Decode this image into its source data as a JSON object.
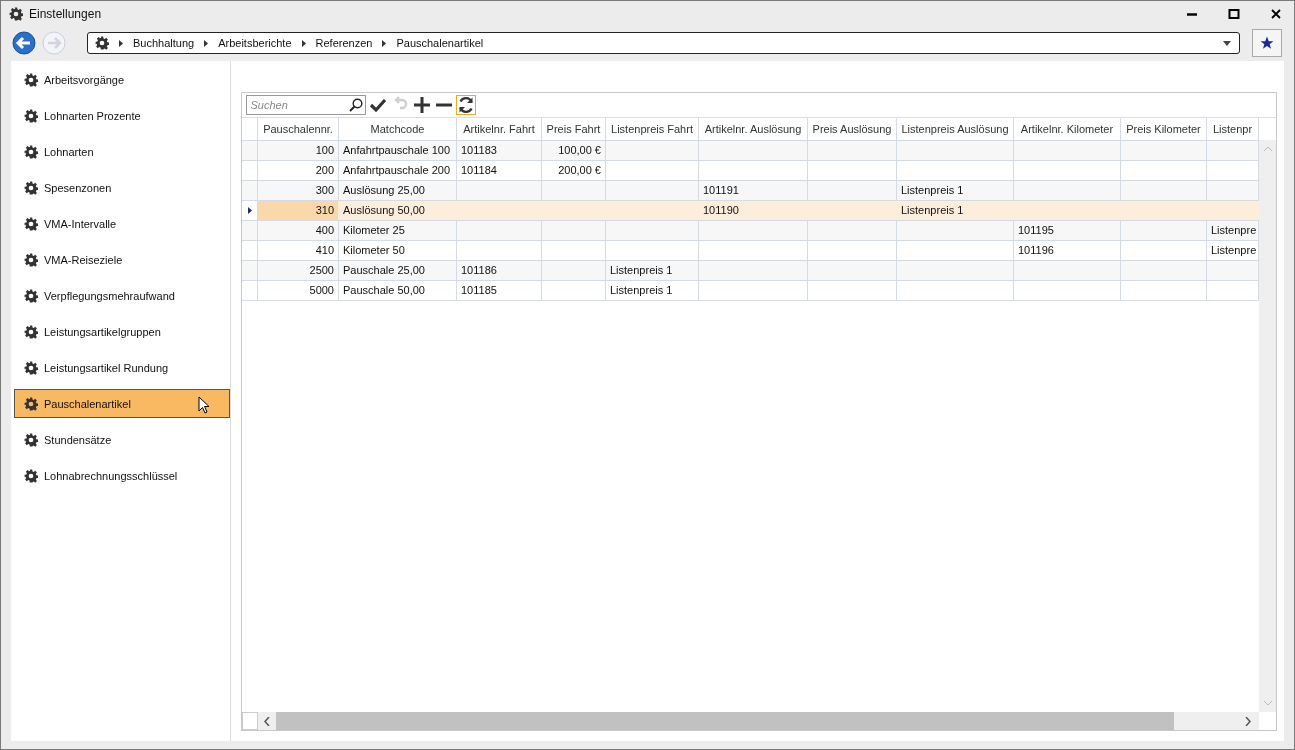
{
  "window": {
    "title": "Einstellungen"
  },
  "breadcrumb": [
    "Buchhaltung",
    "Arbeitsberichte",
    "Referenzen",
    "Pauschalenartikel"
  ],
  "sidebar": {
    "items": [
      {
        "label": "Arbeitsvorgänge",
        "selected": false
      },
      {
        "label": "Lohnarten Prozente",
        "selected": false
      },
      {
        "label": "Lohnarten",
        "selected": false
      },
      {
        "label": "Spesenzonen",
        "selected": false
      },
      {
        "label": "VMA-Intervalle",
        "selected": false
      },
      {
        "label": "VMA-Reiseziele",
        "selected": false
      },
      {
        "label": "Verpflegungsmehraufwand",
        "selected": false
      },
      {
        "label": "Leistungsartikelgruppen",
        "selected": false
      },
      {
        "label": "Leistungsartikel Rundung",
        "selected": false
      },
      {
        "label": "Pauschalenartikel",
        "selected": true
      },
      {
        "label": "Stundensätze",
        "selected": false
      },
      {
        "label": "Lohnabrechnungsschlüssel",
        "selected": false
      }
    ]
  },
  "toolbar": {
    "search": {
      "placeholder": "Suchen"
    },
    "buttons": [
      {
        "kind": "save",
        "disabled": false
      },
      {
        "kind": "undo",
        "disabled": true
      },
      {
        "kind": "add",
        "disabled": false
      },
      {
        "kind": "remove",
        "disabled": false
      },
      {
        "kind": "refresh",
        "disabled": false
      }
    ]
  },
  "table": {
    "columns": [
      "Pauschalennr.",
      "Matchcode",
      "Artikelnr. Fahrt",
      "Preis Fahrt",
      "Listenpreis Fahrt",
      "Artikelnr. Auslösung",
      "Preis Auslösung",
      "Listenpreis Auslösung",
      "Artikelnr. Kilometer",
      "Preis Kilometer",
      "Listenpr"
    ],
    "rows": [
      {
        "selected": false,
        "cells": [
          "100",
          "Anfahrtpauschale 100",
          "101183",
          "100,00 €",
          null,
          null,
          null,
          null,
          null,
          null,
          null
        ]
      },
      {
        "selected": false,
        "cells": [
          "200",
          "Anfahrtpauschale 200",
          "101184",
          "200,00 €",
          null,
          null,
          null,
          null,
          null,
          null,
          null
        ]
      },
      {
        "selected": false,
        "cells": [
          "300",
          "Auslösung 25,00",
          null,
          null,
          null,
          "101191",
          null,
          "Listenpreis 1",
          null,
          null,
          null
        ]
      },
      {
        "selected": true,
        "cells": [
          "310",
          "Auslösung 50,00",
          null,
          null,
          null,
          "101190",
          null,
          "Listenpreis 1",
          null,
          null,
          null
        ]
      },
      {
        "selected": false,
        "cells": [
          "400",
          "Kilometer 25",
          null,
          null,
          null,
          null,
          null,
          null,
          "101195",
          null,
          "Listenpre"
        ]
      },
      {
        "selected": false,
        "cells": [
          "410",
          "Kilometer 50",
          null,
          null,
          null,
          null,
          null,
          null,
          "101196",
          null,
          "Listenpre"
        ]
      },
      {
        "selected": false,
        "cells": [
          "2500",
          "Pauschale 25,00",
          "101186",
          null,
          "Listenpreis 1",
          null,
          null,
          null,
          null,
          null,
          null
        ]
      },
      {
        "selected": false,
        "cells": [
          "5000",
          "Pauschale 50,00",
          "101185",
          null,
          "Listenpreis 1",
          null,
          null,
          null,
          null,
          null,
          null
        ]
      }
    ]
  }
}
